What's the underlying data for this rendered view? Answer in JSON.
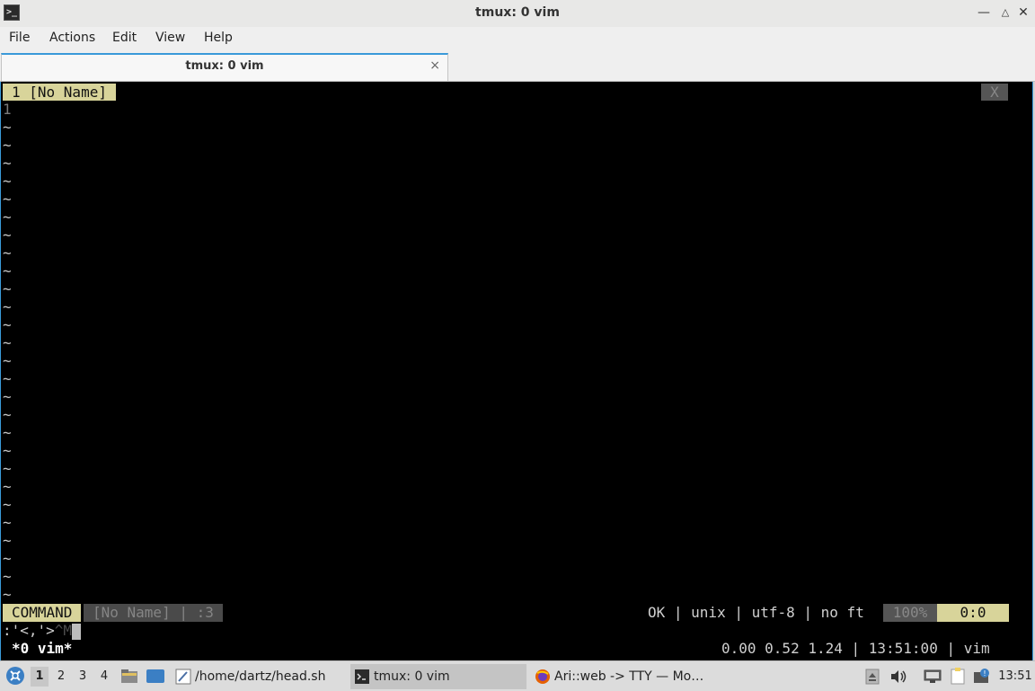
{
  "window": {
    "title": "tmux: 0 vim",
    "app_icon": "terminal-icon",
    "controls": [
      "minimize-icon",
      "maximize-icon",
      "close-icon"
    ]
  },
  "menu": [
    "File",
    "Actions",
    "Edit",
    "View",
    "Help"
  ],
  "tab": {
    "label": "tmux: 0 vim",
    "close": "×"
  },
  "vim": {
    "tabline": {
      "active": "1 [No Name]",
      "close": "X"
    },
    "buffer_line": "1",
    "tilde": "~",
    "statusline": {
      "mode": "COMMAND",
      "file": "[No Name] | :3",
      "right": "OK | unix | utf-8 | no ft",
      "percent": "100%",
      "position": "0:0"
    },
    "cmdline": {
      "text": ":'<,'>",
      "ctrl": "^M"
    }
  },
  "tmux": {
    "window": "*0 vim*",
    "right": "0.00 0.52 1.24 | 13:51:00 | vim"
  },
  "taskbar": {
    "desktops": [
      "1",
      "2",
      "3",
      "4"
    ],
    "active_desktop": "1",
    "tasks": [
      {
        "label": "/home/dartz/head.sh",
        "icon": "text-editor-icon"
      },
      {
        "label": "tmux: 0 vim",
        "icon": "terminal-icon",
        "active": true
      },
      {
        "label": "Ari::web -> TTY — Mo…",
        "icon": "firefox-icon"
      }
    ],
    "clock": "13:51"
  },
  "colors": {
    "accent": "#3a9ad9",
    "vim_tab": "#d8d49a",
    "terminal_bg": "#000000"
  }
}
